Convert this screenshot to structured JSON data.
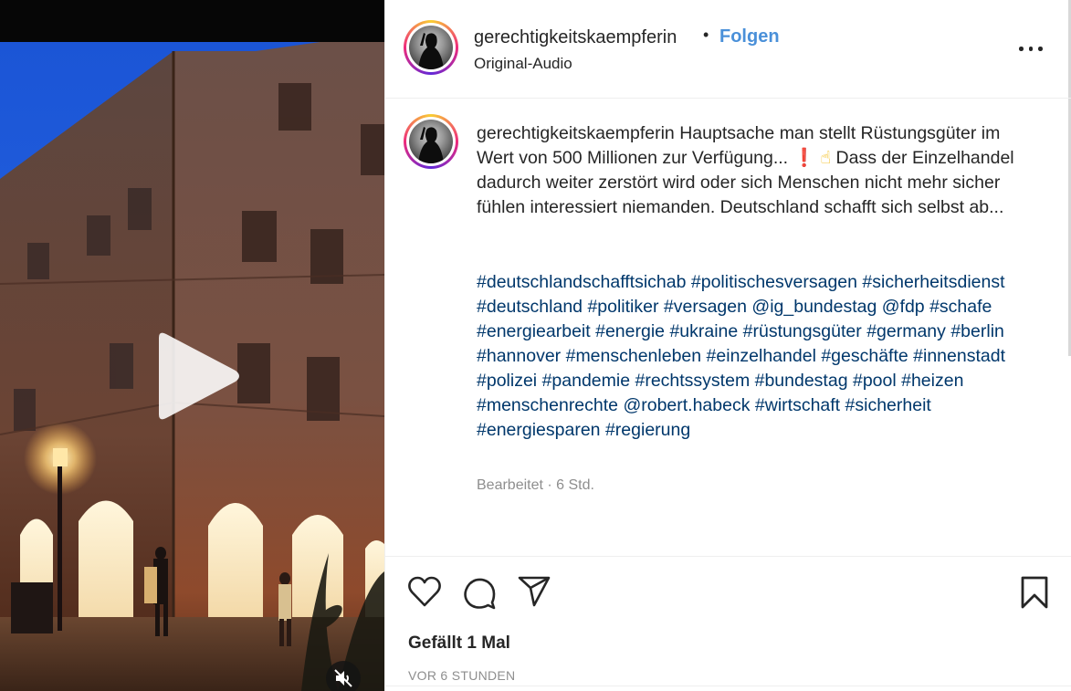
{
  "post": {
    "username": "gerechtigkeitskaempferin",
    "separator": "•",
    "follow_label": "Folgen",
    "audio_label": "Original-Audio",
    "more_icon": "more-horizontal-icon"
  },
  "caption": {
    "username": "gerechtigkeitskaempferin",
    "text_part1": "Hauptsache man stellt Rüstungsgüter im Wert von 500 Millionen zur Verfügung...",
    "emoji_1": "❗",
    "emoji_2": "☝",
    "text_part2": "Dass der Einzelhandel dadurch weiter zerstört wird oder sich Menschen nicht mehr sicher fühlen interessiert niemanden. Deutschland schafft sich selbst ab...",
    "hashtags": [
      "#deutschlandschafftsichab",
      "#politischesversagen",
      "#sicherheitsdienst",
      "#deutschland",
      "#politiker",
      "#versagen",
      "@ig_bundestag",
      "@fdp",
      "#schafe",
      "#energiearbeit",
      "#energie",
      "#ukraine",
      "#rüstungsgüter",
      "#germany",
      "#berlin",
      "#hannover",
      "#menschenleben",
      "#einzelhandel",
      "#geschäfte",
      "#innenstadt",
      "#polizei",
      "#pandemie",
      "#rechtssystem",
      "#bundestag",
      "#pool",
      "#heizen",
      "#menschenrechte",
      "@robert.habeck",
      "#wirtschaft",
      "#sicherheit",
      "#energiesparen",
      "#regierung"
    ],
    "edited": "Bearbeitet · 6 Std."
  },
  "actions": {
    "like_icon": "heart-icon",
    "comment_icon": "comment-icon",
    "share_icon": "paper-plane-icon",
    "save_icon": "bookmark-icon"
  },
  "likes_text": "Gefällt 1 Mal",
  "timestamp": "VOR 6 STUNDEN",
  "video": {
    "play_icon": "play-icon",
    "mute_icon": "speaker-muted-icon"
  }
}
